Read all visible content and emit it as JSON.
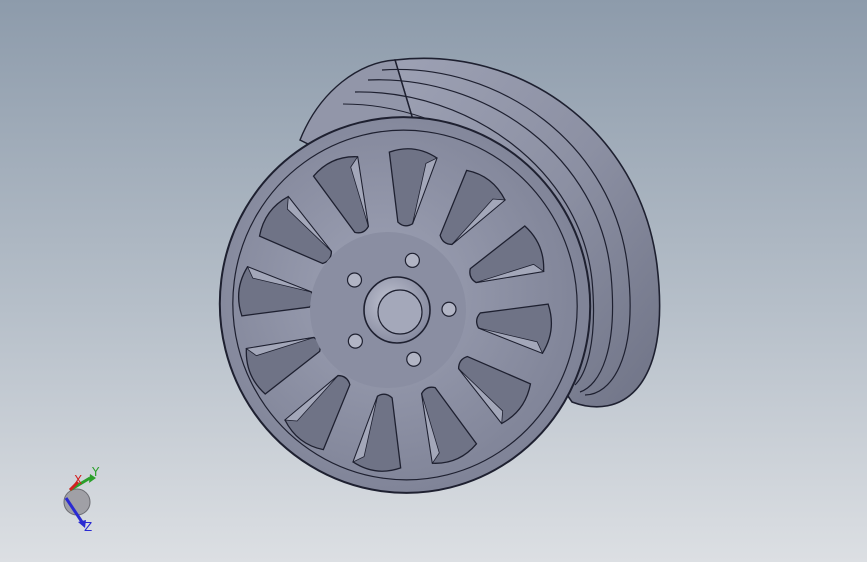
{
  "view": {
    "background_top": "#8d9bab",
    "background_bottom": "#dcdfe3",
    "part_color": "#8e92a6",
    "edge_color": "#1e2030"
  },
  "model": {
    "name": "wheel-rim",
    "spoke_pairs": 12,
    "lug_holes": 5
  },
  "triad": {
    "x_label": "X",
    "y_label": "Y",
    "z_label": "Z",
    "x_color": "#d22020",
    "y_color": "#2aa02a",
    "z_color": "#2a2ad2"
  }
}
